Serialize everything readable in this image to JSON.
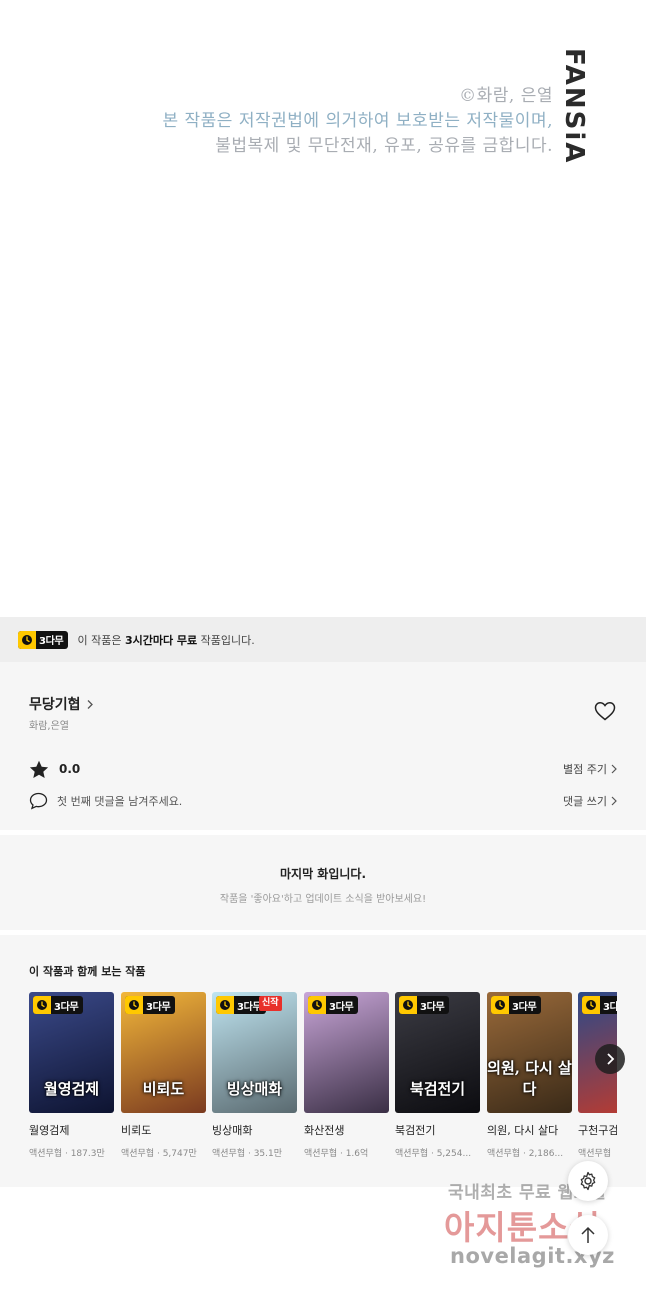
{
  "copyright": {
    "lines": [
      "©화람, 은열",
      "본 작품은 저작권법에 의거하여 보호받는 저작물이며,",
      "불법복제 및 무단전재, 유포, 공유를 금합니다."
    ],
    "brand": "FANSiA"
  },
  "free_notice": {
    "badge": "3다무",
    "text_before": "이 작품은 ",
    "text_bold": "3시간마다 무료",
    "text_after": " 작품입니다."
  },
  "series": {
    "title": "무당기협",
    "author": "화람,은열",
    "rating": "0.0",
    "rate_link": "별점 주기",
    "comment_placeholder": "첫 번째 댓글을 남겨주세요.",
    "comment_link": "댓글 쓰기"
  },
  "last_episode": {
    "title": "마지막 화입니다.",
    "subtitle": "작품을 '좋아요'하고 업데이트 소식을 받아보세요!"
  },
  "recommendations": {
    "title": "이 작품과 함께 보는 작품",
    "items": [
      {
        "name": "월영검제",
        "meta": "액션무협 · 187.3만",
        "badge": "3다무",
        "new": "",
        "art": "월영검제",
        "colors": [
          "#3b4a8a",
          "#0d1330"
        ]
      },
      {
        "name": "비뢰도",
        "meta": "액션무협 · 5,747만",
        "badge": "3다무",
        "new": "",
        "art": "비뢰도",
        "colors": [
          "#f2b73a",
          "#7a3a20"
        ]
      },
      {
        "name": "빙상매화",
        "meta": "액션무협 · 35.1만",
        "badge": "3다무",
        "new": "신작",
        "art": "빙상매화",
        "colors": [
          "#bfe4f0",
          "#5a6a70"
        ]
      },
      {
        "name": "화산전생",
        "meta": "액션무협 · 1.6억",
        "badge": "3다무",
        "new": "",
        "art": "",
        "colors": [
          "#c9a6d8",
          "#3a2f45"
        ]
      },
      {
        "name": "북검전기",
        "meta": "액션무협 · 5,254...",
        "badge": "3다무",
        "new": "",
        "art": "북검전기",
        "colors": [
          "#3c3c44",
          "#0c0c10"
        ]
      },
      {
        "name": "의원, 다시 살다",
        "meta": "액션무협 · 2,186...",
        "badge": "3다무",
        "new": "",
        "art": "의원, 다시 살다",
        "colors": [
          "#9a6a3a",
          "#3a2a18"
        ]
      },
      {
        "name": "구천구검",
        "meta": "액션무협",
        "badge": "3다",
        "new": "",
        "art": "",
        "colors": [
          "#2a4a8a",
          "#c43a2a"
        ]
      }
    ]
  },
  "icons": {
    "clock": "clock-icon",
    "heart": "heart-icon",
    "star": "star-icon",
    "comment": "speech-bubble-icon",
    "chevron": "chevron-right-icon",
    "settings": "gear-icon",
    "top": "arrow-up-icon"
  },
  "watermark": {
    "line1": "국내최초 무료 웹소설",
    "line2": "아지툰소설",
    "line3": "novelagit.xyz"
  },
  "colors": {
    "badge_clock": "#ffc800",
    "badge_bg": "#111111",
    "panel_bg": "#f6f6f6",
    "free_bar_bg": "#eeeeee",
    "new_tag": "#e8302a"
  }
}
